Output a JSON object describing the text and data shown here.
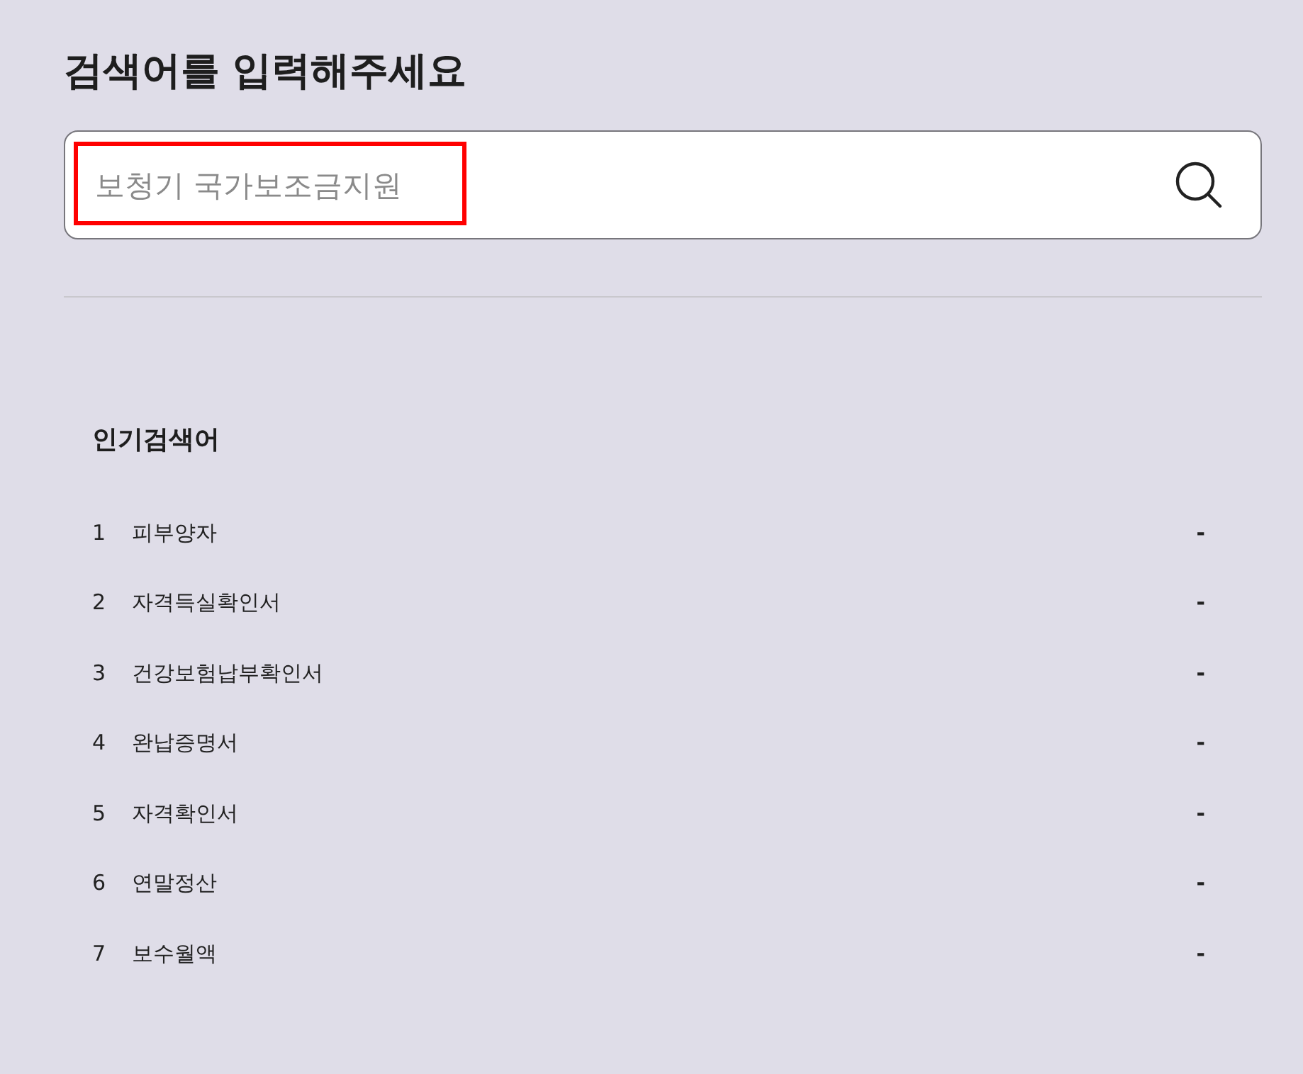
{
  "page": {
    "title": "검색어를 입력해주세요"
  },
  "search": {
    "placeholder": "보청기 국가보조금지원",
    "highlighted": true
  },
  "popular": {
    "title": "인기검색어",
    "items": [
      {
        "rank": "1",
        "keyword": "피부양자",
        "change": "-"
      },
      {
        "rank": "2",
        "keyword": "자격득실확인서",
        "change": "-"
      },
      {
        "rank": "3",
        "keyword": "건강보험납부확인서",
        "change": "-"
      },
      {
        "rank": "4",
        "keyword": "완납증명서",
        "change": "-"
      },
      {
        "rank": "5",
        "keyword": "자격확인서",
        "change": "-"
      },
      {
        "rank": "6",
        "keyword": "연말정산",
        "change": "-"
      },
      {
        "rank": "7",
        "keyword": "보수월액",
        "change": "-"
      }
    ]
  }
}
